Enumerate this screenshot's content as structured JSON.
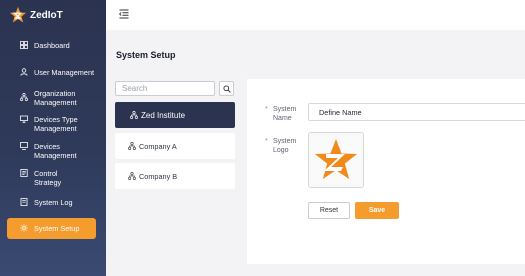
{
  "app": {
    "name": "ZedIoT"
  },
  "sidebar": {
    "items": [
      {
        "label": "Dashboard",
        "icon": "dashboard-icon"
      },
      {
        "label": "User Management",
        "icon": "user-icon"
      },
      {
        "label": "Organization\nManagement",
        "icon": "organization-icon"
      },
      {
        "label": "Devices Type\nManagement",
        "icon": "devices-type-icon"
      },
      {
        "label": "Devices\nManagement",
        "icon": "devices-icon"
      },
      {
        "label": "Control\nStrategy",
        "icon": "control-icon"
      },
      {
        "label": "System Log",
        "icon": "log-icon"
      },
      {
        "label": "System Setup",
        "icon": "gear-icon",
        "active": true
      }
    ]
  },
  "page": {
    "title": "System Setup"
  },
  "search": {
    "placeholder": "Search"
  },
  "organizations": [
    {
      "label": "Zed Institute",
      "active": true
    },
    {
      "label": "Company A"
    },
    {
      "label": "Company B"
    }
  ],
  "form": {
    "name_label_1": "System",
    "name_label_2": "Name",
    "name_value": "Define Name",
    "logo_label_1": "System",
    "logo_label_2": "Logo",
    "required_mark": "*",
    "reset_label": "Reset",
    "save_label": "Save"
  },
  "colors": {
    "sidebar": "#2b3350",
    "accent": "#f59c2f"
  }
}
